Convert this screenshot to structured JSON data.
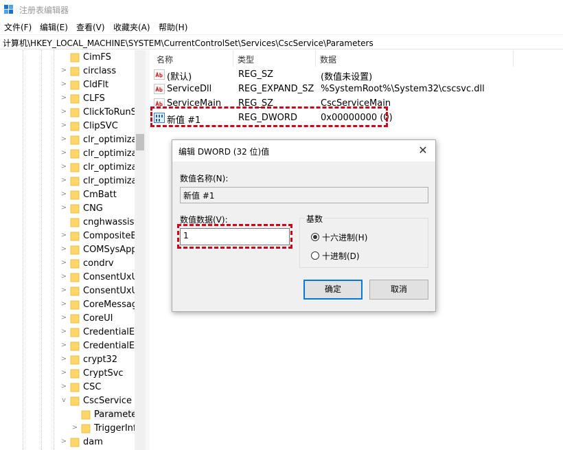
{
  "window": {
    "title": "注册表编辑器"
  },
  "menu": [
    "文件(F)",
    "编辑(E)",
    "查看(V)",
    "收藏夹(A)",
    "帮助(H)"
  ],
  "address": "计算机\\HKEY_LOCAL_MACHINE\\SYSTEM\\CurrentControlSet\\Services\\CscService\\Parameters",
  "tree": {
    "items": [
      {
        "label": "CimFS",
        "expander": ""
      },
      {
        "label": "circlass",
        "expander": ">"
      },
      {
        "label": "CldFlt",
        "expander": ">"
      },
      {
        "label": "CLFS",
        "expander": ">"
      },
      {
        "label": "ClickToRunSv",
        "expander": ">"
      },
      {
        "label": "ClipSVC",
        "expander": ">"
      },
      {
        "label": "clr_optimizati",
        "expander": ">"
      },
      {
        "label": "clr_optimizati",
        "expander": ">"
      },
      {
        "label": "clr_optimizati",
        "expander": ">"
      },
      {
        "label": "clr_optimizati",
        "expander": ">"
      },
      {
        "label": "CmBatt",
        "expander": ">"
      },
      {
        "label": "CNG",
        "expander": ">"
      },
      {
        "label": "cnghwassist",
        "expander": ""
      },
      {
        "label": "CompositeBu",
        "expander": ">"
      },
      {
        "label": "COMSysApp",
        "expander": ">"
      },
      {
        "label": "condrv",
        "expander": ">"
      },
      {
        "label": "ConsentUxUs",
        "expander": ">"
      },
      {
        "label": "ConsentUxUs",
        "expander": ">"
      },
      {
        "label": "CoreMessag",
        "expander": ">"
      },
      {
        "label": "CoreUI",
        "expander": ">"
      },
      {
        "label": "CredentialEn",
        "expander": ">"
      },
      {
        "label": "CredentialEn",
        "expander": ">"
      },
      {
        "label": "crypt32",
        "expander": ">"
      },
      {
        "label": "CryptSvc",
        "expander": ">"
      },
      {
        "label": "CSC",
        "expander": ">"
      },
      {
        "label": "CscService",
        "expander": "v"
      },
      {
        "label": "Parameter",
        "expander": ""
      },
      {
        "label": "TriggerInf",
        "expander": ">"
      },
      {
        "label": "dam",
        "expander": ">"
      }
    ]
  },
  "list": {
    "columns": [
      "名称",
      "类型",
      "数据"
    ],
    "rows": [
      {
        "name": "(默认)",
        "type": "REG_SZ",
        "data": "(数值未设置)",
        "icon": "ab-string-icon"
      },
      {
        "name": "ServiceDll",
        "type": "REG_EXPAND_SZ",
        "data": "%SystemRoot%\\System32\\cscsvc.dll",
        "icon": "ab-string-icon"
      },
      {
        "name": "ServiceMain",
        "type": "REG_SZ",
        "data": "CscServiceMain",
        "icon": "ab-string-icon"
      },
      {
        "name": "新值 #1",
        "type": "REG_DWORD",
        "data": "0x00000000 (0)",
        "icon": "binary-value-icon"
      }
    ]
  },
  "dialog": {
    "title": "编辑 DWORD (32 位)值",
    "close": "✕",
    "name_label": "数值名称(N):",
    "name_value": "新值 #1",
    "data_label": "数值数据(V):",
    "data_value": "1",
    "base_label": "基数",
    "hex_label": "十六进制(H)",
    "dec_label": "十进制(D)",
    "selected_base": "hex",
    "ok": "确定",
    "cancel": "取消"
  },
  "colors": {
    "highlight": "#d0021b",
    "folder": "#ffd766",
    "accent": "#0078d7"
  }
}
